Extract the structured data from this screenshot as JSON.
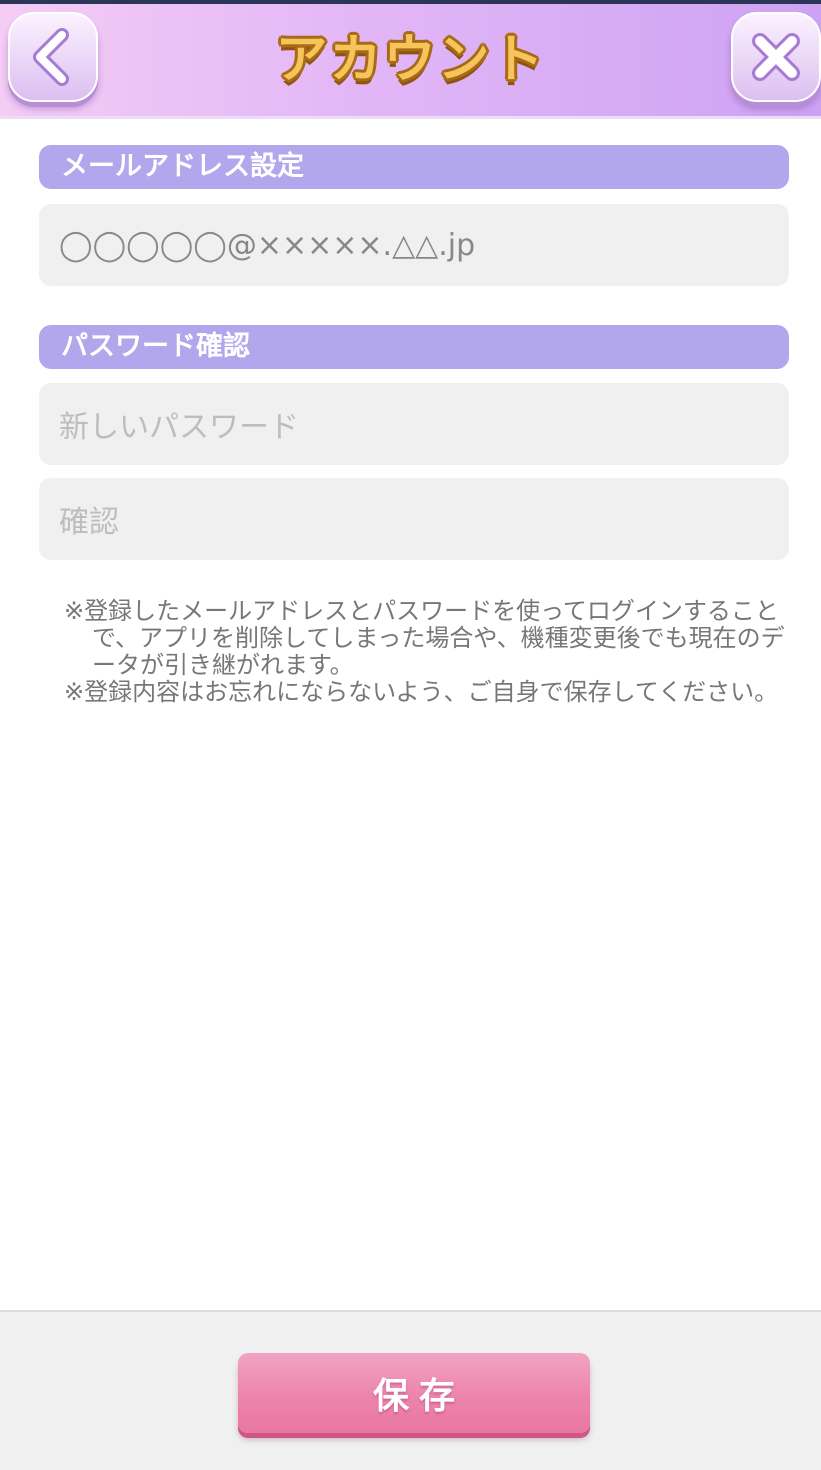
{
  "header": {
    "title": "アカウント",
    "back_icon": "chevron-left-icon",
    "close_icon": "close-icon"
  },
  "email_section": {
    "label": "メールアドレス設定",
    "value": "◯◯◯◯◯@×××××.△△.jp"
  },
  "password_section": {
    "label": "パスワード確認",
    "new_password_placeholder": "新しいパスワード",
    "confirm_placeholder": "確認"
  },
  "notes": [
    "※登録したメールアドレスとパスワードを使ってログインすることで、アプリを削除してしまった場合や、機種変更後でも現在のデータが引き継がれます。",
    "※登録内容はお忘れにならないよう、ご自身で保存してください。"
  ],
  "footer": {
    "save_label": "保存"
  },
  "colors": {
    "header_gradient_start": "#f4ccf5",
    "header_gradient_end": "#cda2f3",
    "title_gold": "#f5c45a",
    "section_label_bg": "#b2a6ec",
    "field_bg": "#f0f0f0",
    "save_button": "#ec84ac"
  }
}
